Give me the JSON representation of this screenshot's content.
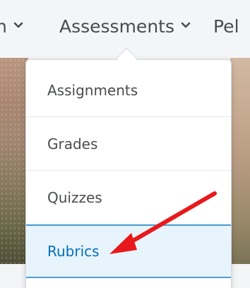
{
  "navbar": {
    "prev_item": "n",
    "assessments_label": "Assessments",
    "next_item": "Pel"
  },
  "dropdown": {
    "items": [
      {
        "label": "Assignments"
      },
      {
        "label": "Grades"
      },
      {
        "label": "Quizzes"
      },
      {
        "label": "Rubrics"
      }
    ]
  },
  "colors": {
    "nav_text": "#494c4e",
    "active_bg": "#e8f4fb",
    "active_border": "#4a9fd5",
    "active_text": "#006fbf",
    "arrow": "#e8191c"
  },
  "annotation": {
    "icon": "red-arrow-icon",
    "points_to": "Rubrics"
  }
}
